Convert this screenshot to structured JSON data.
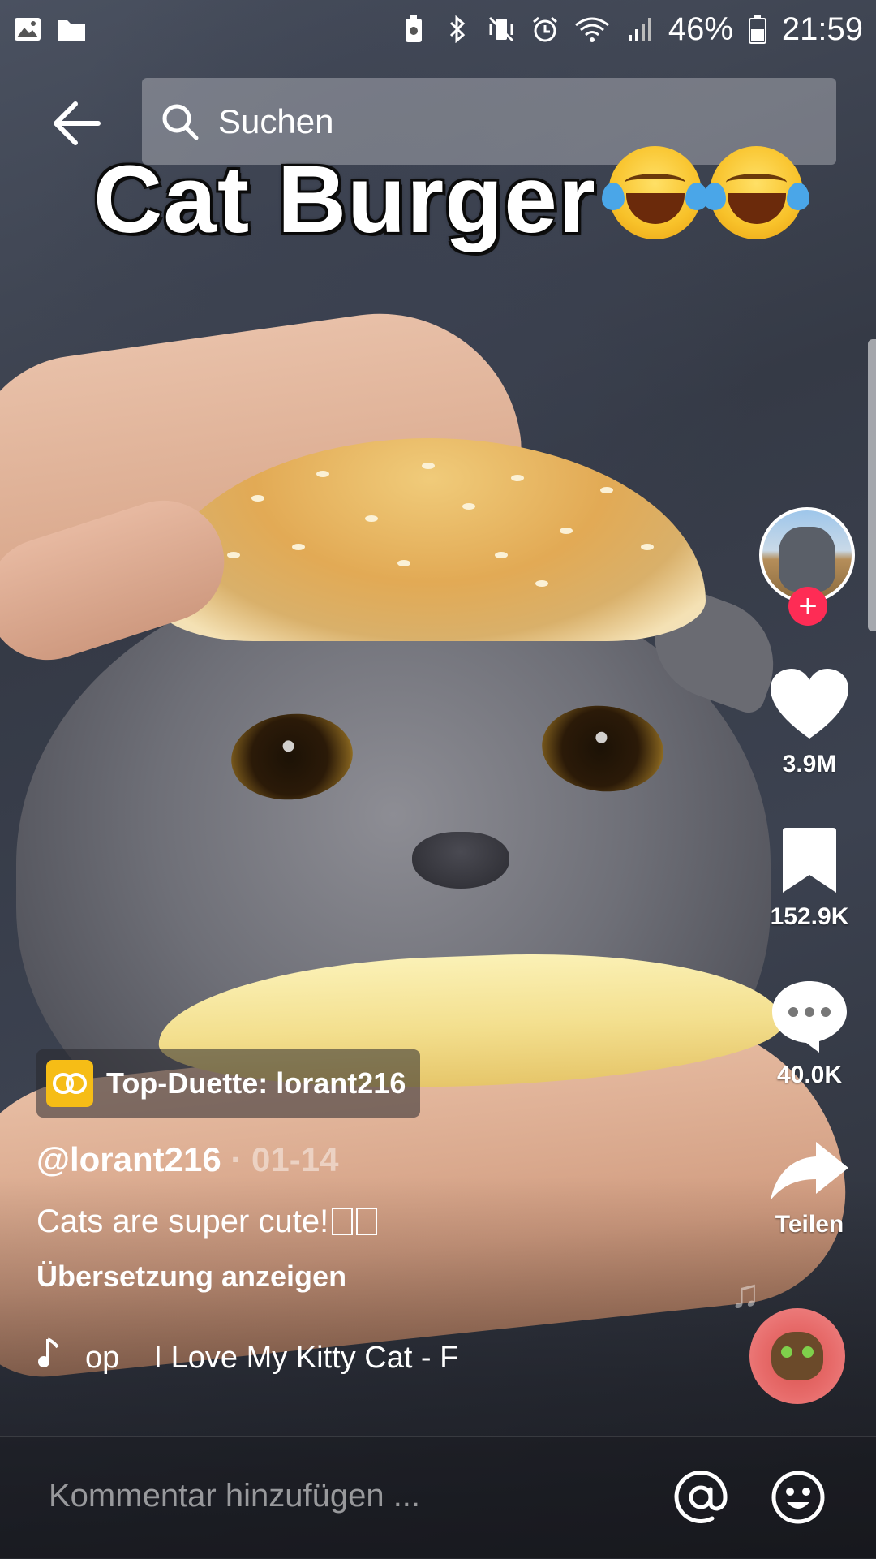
{
  "status_bar": {
    "left_icons": [
      "gallery-icon",
      "folder-icon"
    ],
    "right_icons": [
      "battery-saver-icon",
      "bluetooth-icon",
      "vibrate-off-icon",
      "alarm-icon",
      "wifi-icon",
      "signal-icon"
    ],
    "battery_percent": "46%",
    "time": "21:59"
  },
  "header": {
    "search_placeholder": "Suchen"
  },
  "video": {
    "caption_text": "Cat Burger"
  },
  "rail": {
    "likes": "3.9M",
    "bookmarks": "152.9K",
    "comments": "40.0K",
    "share_label": "Teilen"
  },
  "post": {
    "duet_badge": "Top-Duette: lorant216",
    "username": "@lorant216",
    "date_separator": " · ",
    "date": "01-14",
    "description": "Cats are super cute!",
    "translate_link": "Übersetzung anzeigen",
    "sound_title": "op    I Love My Kitty Cat - F"
  },
  "comment_bar": {
    "placeholder": "Kommentar hinzufügen ..."
  },
  "colors": {
    "follow_accent": "#fe2c55",
    "duet_badge_icon": "#f6bd16"
  }
}
